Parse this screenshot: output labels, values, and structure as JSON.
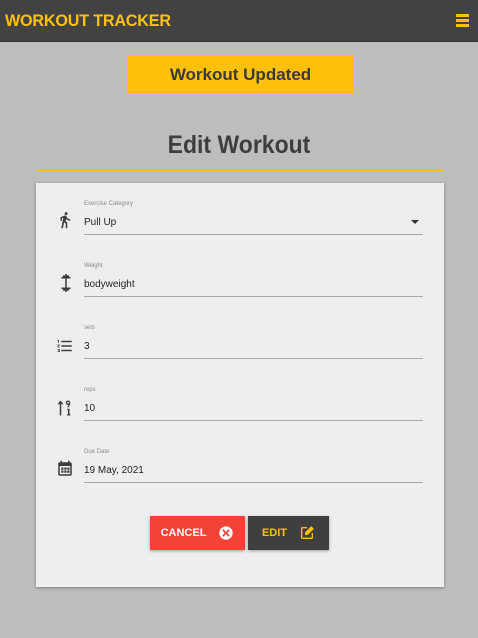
{
  "header": {
    "brand": "WORKOUT TRACKER",
    "menu_icon": "hamburger-menu-icon"
  },
  "toast": {
    "message": "Workout Updated"
  },
  "page": {
    "title": "Edit Workout"
  },
  "form": {
    "fields": [
      {
        "label": "Exercise Category",
        "value": "Pull Up",
        "icon": "running-person-icon",
        "type": "select"
      },
      {
        "label": "Weight",
        "value": "bodyweight",
        "icon": "dumbbell-icon",
        "type": "text"
      },
      {
        "label": "sets",
        "value": "3",
        "icon": "numbered-list-icon",
        "type": "text"
      },
      {
        "label": "reps",
        "value": "10",
        "icon": "sort-numeric-icon",
        "type": "text"
      },
      {
        "label": "Due Date",
        "value": "19 May, 2021",
        "icon": "calendar-icon",
        "type": "text"
      }
    ],
    "cancel_label": "CANCEL",
    "edit_label": "EDIT"
  },
  "colors": {
    "accent": "#ffc107",
    "header_bg": "#424242",
    "page_bg": "#bdbdbd",
    "card_bg": "#eeeeee",
    "cancel": "#f44336",
    "edit_bg": "#3f3f3f"
  }
}
